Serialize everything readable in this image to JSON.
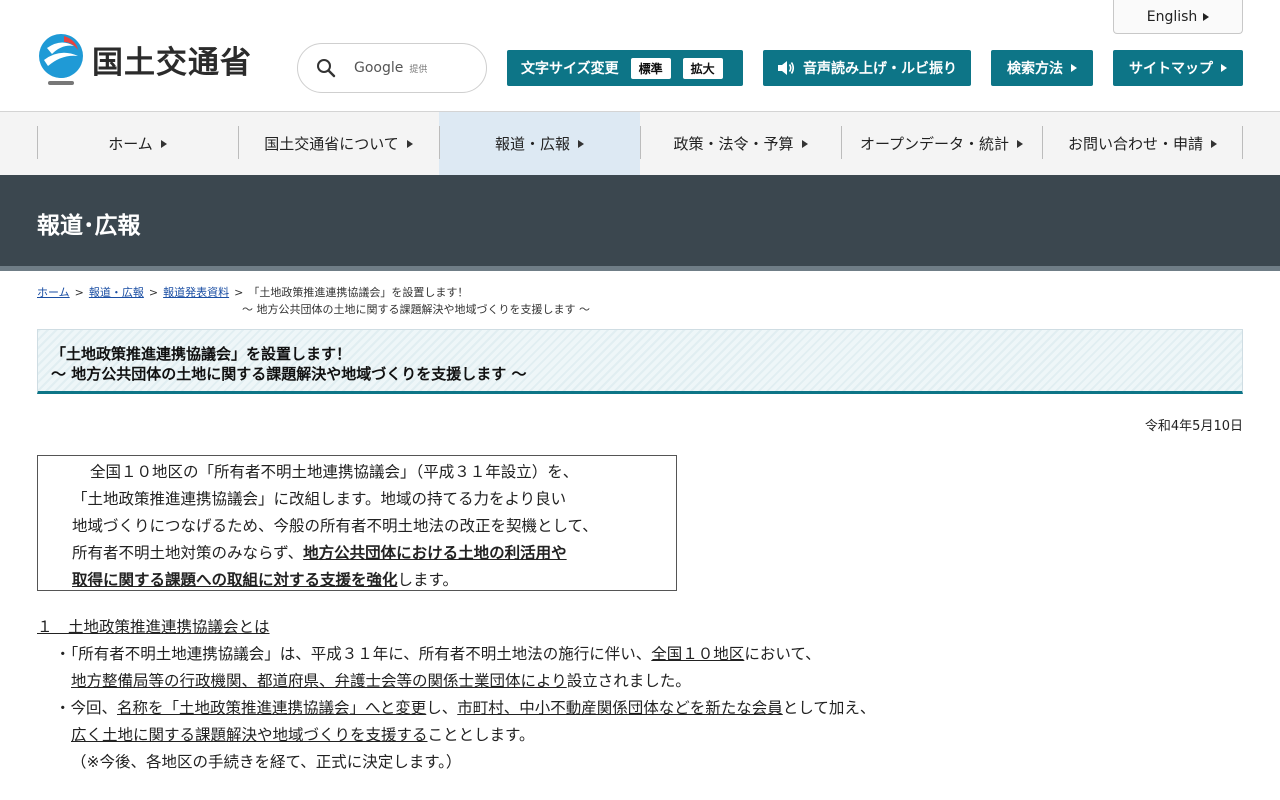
{
  "header": {
    "logo_text": "国土交通省",
    "english_label": "English",
    "search": {
      "google_label": "Google",
      "provided_label": "提供"
    },
    "font_size": {
      "label": "文字サイズ変更",
      "standard": "標準",
      "large": "拡大"
    },
    "speech_label": "音声読み上げ・ルビ振り",
    "howto_label": "検索方法",
    "sitemap_label": "サイトマップ"
  },
  "nav": {
    "items": [
      {
        "label": "ホーム"
      },
      {
        "label": "国土交通省について"
      },
      {
        "label": "報道・広報"
      },
      {
        "label": "政策・法令・予算"
      },
      {
        "label": "オープンデータ・統計"
      },
      {
        "label": "お問い合わせ・申請"
      }
    ],
    "active_index": 2
  },
  "banner": {
    "title": "報道･広報"
  },
  "breadcrumb": {
    "home": "ホーム",
    "press": "報道・広報",
    "releases": "報道発表資料",
    "current_line1": "「土地政策推進連携協議会」を設置します！",
    "current_line2": "～ 地方公共団体の土地に関する課題解決や地域づくりを支援します ～"
  },
  "article": {
    "title_line1": "「土地政策推進連携協議会」を設置します！",
    "title_line2": "～ 地方公共団体の土地に関する課題解決や地域づくりを支援します ～",
    "date": "令和4年5月10日",
    "summary": {
      "l1": "全国１０地区の「所有者不明土地連携協議会」（平成３１年設立）を、",
      "l2": "「土地政策推進連携協議会」に改組します。地域の持てる力をより良い",
      "l3": "地域づくりにつなげるため、今般の所有者不明土地法の改正を契機として、",
      "l4a": "所有者不明土地対策のみならず、",
      "l4b": "地方公共団体における土地の利活用や",
      "l5a": "取得に関する課題への取組に対する支援を強化",
      "l5b": "します。"
    },
    "section1": {
      "heading": "１　土地政策推進連携協議会とは",
      "p1a": "・「所有者不明土地連携協議会」は、平成３１年に、所有者不明土地法の施行に伴い、",
      "p1b": "全国１０地区",
      "p1c": "において、",
      "p2a": "地方整備局等の行政機関、都道府県、弁護士会等の関係士業団体により",
      "p2b": "設立されました。",
      "p3a": "・今回、",
      "p3b": "名称を「土地政策推進連携協議会」へと変更",
      "p3c": "し、",
      "p3d": "市町村、中小不動産関係団体などを新たな会員",
      "p3e": "として加え、",
      "p4a": "広く土地に関する課題解決や地域づくりを支援する",
      "p4b": "こととします。",
      "p5": "（※今後、各地区の手続きを経て、正式に決定します。）"
    }
  },
  "colors": {
    "accent": "#0d7587",
    "banner": "#3b474f",
    "nav_active": "#dde9f3",
    "link": "#1a4ea3"
  }
}
